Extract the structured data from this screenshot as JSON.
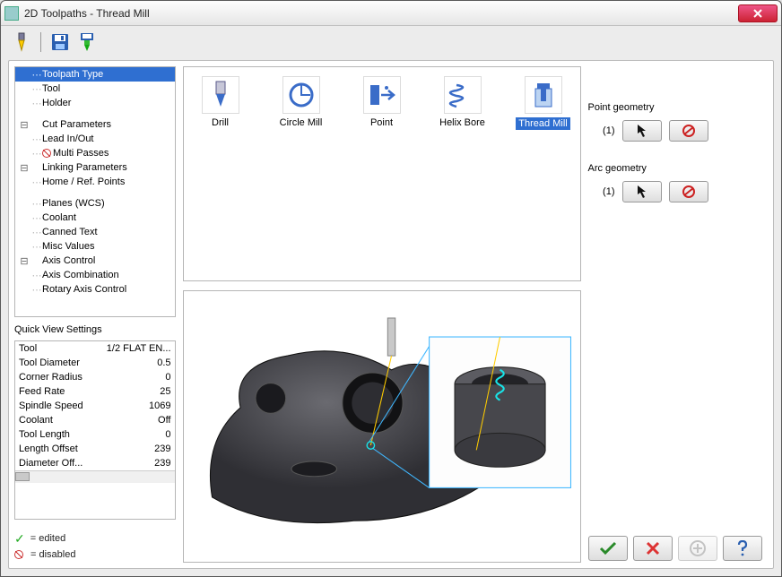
{
  "window": {
    "title": "2D Toolpaths - Thread Mill"
  },
  "toolbar": {
    "tool_icon": "tool-icon",
    "save_icon": "save-icon",
    "machine_icon": "machine-icon"
  },
  "tree": {
    "items": [
      {
        "label": "Toolpath Type",
        "level": 1,
        "selected": true
      },
      {
        "label": "Tool",
        "level": 1
      },
      {
        "label": "Holder",
        "level": 1
      },
      {
        "label": "",
        "level": 0,
        "blank": true
      },
      {
        "label": "Cut Parameters",
        "level": 0,
        "expandable": true
      },
      {
        "label": "Lead In/Out",
        "level": 1
      },
      {
        "label": "Multi Passes",
        "level": 1,
        "disabled": true
      },
      {
        "label": "Linking Parameters",
        "level": 0,
        "expandable": true
      },
      {
        "label": "Home / Ref. Points",
        "level": 1
      },
      {
        "label": "",
        "level": 0,
        "blank": true
      },
      {
        "label": "Planes (WCS)",
        "level": 1
      },
      {
        "label": "Coolant",
        "level": 1
      },
      {
        "label": "Canned Text",
        "level": 1
      },
      {
        "label": "Misc Values",
        "level": 1
      },
      {
        "label": "Axis Control",
        "level": 0,
        "expandable": true
      },
      {
        "label": "Axis Combination",
        "level": 1
      },
      {
        "label": "Rotary Axis Control",
        "level": 1
      }
    ]
  },
  "quick_view": {
    "title": "Quick View Settings",
    "rows": [
      {
        "label": "Tool",
        "value": "1/2 FLAT EN..."
      },
      {
        "label": "Tool Diameter",
        "value": "0.5"
      },
      {
        "label": "Corner Radius",
        "value": "0"
      },
      {
        "label": "Feed Rate",
        "value": "25"
      },
      {
        "label": "Spindle Speed",
        "value": "1069"
      },
      {
        "label": "Coolant",
        "value": "Off"
      },
      {
        "label": "Tool Length",
        "value": "0"
      },
      {
        "label": "Length Offset",
        "value": "239"
      },
      {
        "label": "Diameter Off...",
        "value": "239"
      }
    ]
  },
  "legend": {
    "edited": "= edited",
    "disabled": "= disabled"
  },
  "types": [
    {
      "label": "Drill"
    },
    {
      "label": "Circle Mill"
    },
    {
      "label": "Point"
    },
    {
      "label": "Helix Bore"
    },
    {
      "label": "Thread Mill",
      "selected": true
    }
  ],
  "geometry": {
    "point": {
      "label": "Point geometry",
      "count": "(1)"
    },
    "arc": {
      "label": "Arc geometry",
      "count": "(1)"
    }
  },
  "footer": {
    "ok": "ok",
    "cancel": "cancel",
    "add": "add",
    "help": "help"
  }
}
